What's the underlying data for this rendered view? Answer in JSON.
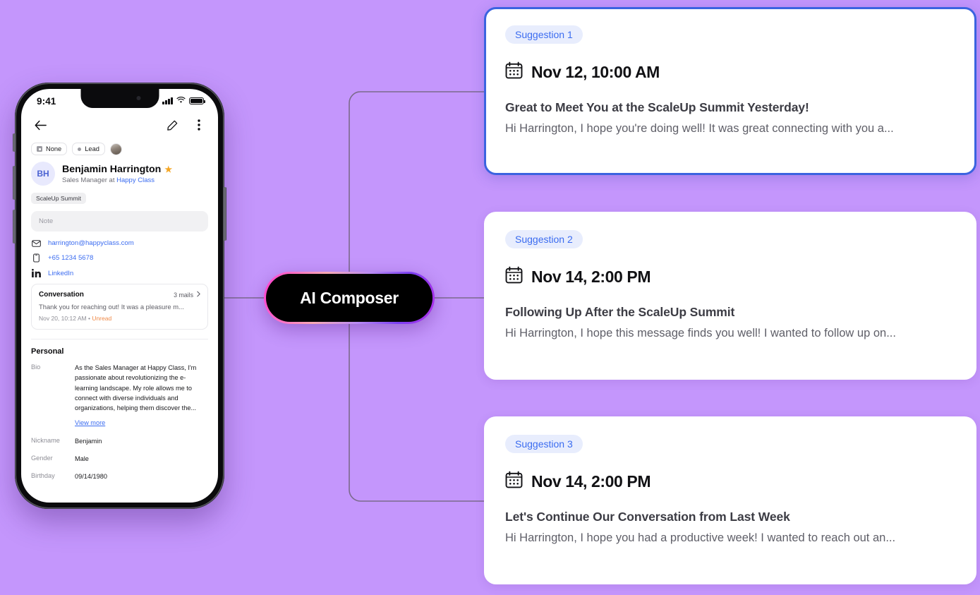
{
  "background_color": "#c496fc",
  "connector_color": "#7b6a8c",
  "phone": {
    "status_bar": {
      "time": "9:41",
      "signal_icon": "cellular-bars-icon",
      "wifi_icon": "wifi-icon",
      "battery_icon": "battery-icon"
    },
    "nav": {
      "back_icon": "back-arrow-icon",
      "edit_icon": "pencil-edit-icon",
      "more_icon": "more-vertical-icon"
    },
    "chips": [
      {
        "label": "None",
        "icon": "square-status-icon"
      },
      {
        "label": "Lead",
        "icon": "dot-icon"
      }
    ],
    "avatar_thumb": "contact-photo-icon",
    "contact": {
      "initials": "BH",
      "name": "Benjamin Harrington",
      "star_icon": "star-icon",
      "role_prefix": "Sales Manager",
      "role_at": "at",
      "company": "Happy Class",
      "tag": "ScaleUp Summit"
    },
    "note_placeholder": "Note",
    "contact_methods": [
      {
        "icon": "envelope-icon",
        "value": "harrington@happyclass.com"
      },
      {
        "icon": "phone-icon",
        "value": "+65 1234 5678"
      },
      {
        "icon": "linkedin-icon",
        "value": "LinkedIn"
      }
    ],
    "conversation": {
      "title": "Conversation",
      "count": "3 mails",
      "chevron_icon": "chevron-right-icon",
      "snippet": "Thank you for reaching out! It was a pleasure m...",
      "date": "Nov 20, 10:12 AM",
      "separator": "•",
      "status": "Unread"
    },
    "personal": {
      "title": "Personal",
      "fields": [
        {
          "key": "Bio",
          "value": "As the Sales Manager at Happy Class, I'm passionate about revolutionizing the e-learning landscape. My role allows me to connect with diverse individuals and organizations, helping them discover the...",
          "more_label": "View more"
        },
        {
          "key": "Nickname",
          "value": "Benjamin"
        },
        {
          "key": "Gender",
          "value": "Male"
        },
        {
          "key": "Birthday",
          "value": "09/14/1980"
        }
      ]
    }
  },
  "composer": {
    "label": "AI Composer",
    "border_gradient_from": "#ff3fd0",
    "border_gradient_to": "#7b3ff2"
  },
  "suggestions": {
    "badge_bg": "#e8edfd",
    "badge_color": "#3b6cf0",
    "active_border_color": "#3b63e0",
    "items": [
      {
        "badge": "Suggestion 1",
        "calendar_icon": "calendar-icon",
        "date": "Nov 12, 10:00 AM",
        "subject": "Great to Meet You at the ScaleUp Summit Yesterday!",
        "preview": "Hi Harrington,  I hope you're doing well! It was great connecting with you a...",
        "selected": true
      },
      {
        "badge": "Suggestion 2",
        "calendar_icon": "calendar-icon",
        "date": "Nov 14, 2:00 PM",
        "subject": "Following Up After the ScaleUp Summit",
        "preview": "Hi Harrington,  I hope this message finds you well! I wanted to follow up on...",
        "selected": false
      },
      {
        "badge": "Suggestion 3",
        "calendar_icon": "calendar-icon",
        "date": "Nov 14, 2:00 PM",
        "subject": "Let's Continue Our Conversation from Last Week",
        "preview": "Hi Harrington,  I hope you had a productive week! I wanted to reach out an...",
        "selected": false
      }
    ]
  }
}
